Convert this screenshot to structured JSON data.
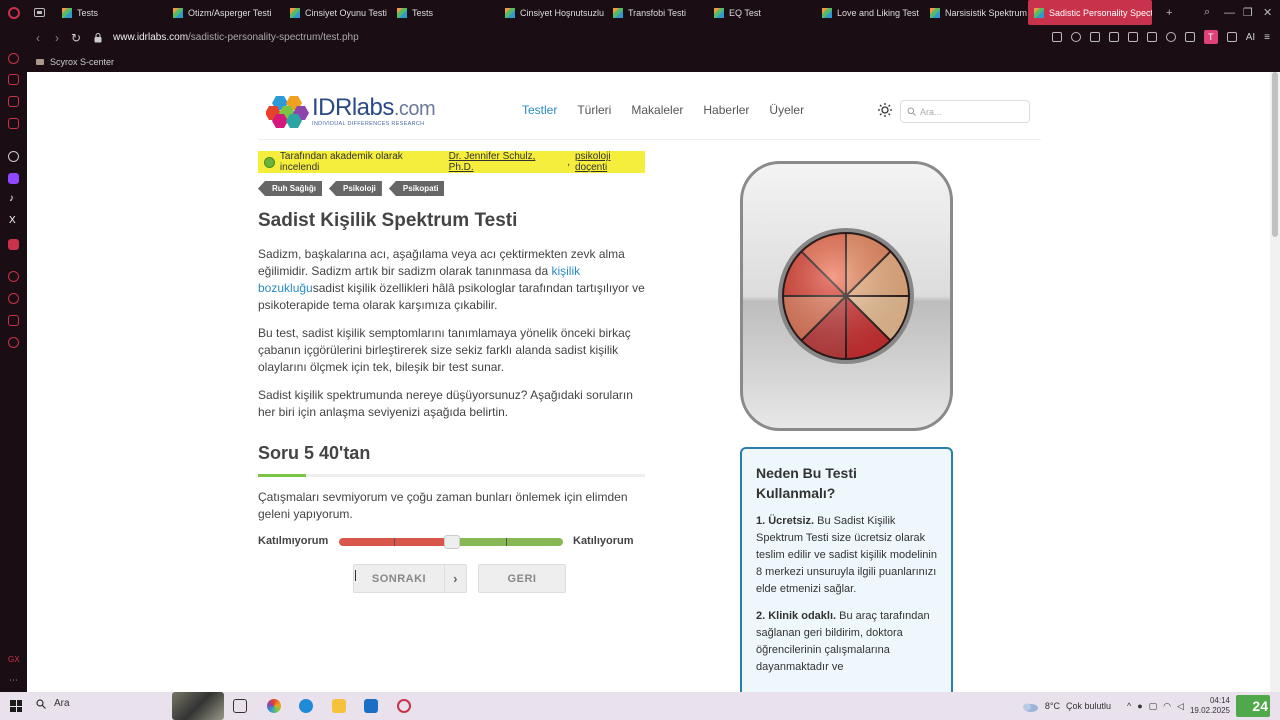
{
  "browser": {
    "tabs": [
      {
        "label": "Tests",
        "active": false
      },
      {
        "label": "Otizm/Asperger Testi",
        "active": false
      },
      {
        "label": "Cinsiyet Oyunu Testi",
        "active": false
      },
      {
        "label": "Tests",
        "active": false
      },
      {
        "label": "Cinsiyet Hoşnutsuzlu",
        "active": false
      },
      {
        "label": "Transfobi Testi",
        "active": false
      },
      {
        "label": "EQ Test",
        "active": false
      },
      {
        "label": "Love and Liking Test",
        "active": false
      },
      {
        "label": "Narsisistik Spektrum",
        "active": false
      },
      {
        "label": "Sadistic Personality Spect",
        "active": true
      }
    ],
    "new_tab": "+",
    "url_host": "www.idrlabs.com",
    "url_path": "/sadistic-personality-spectrum/test.php",
    "bookmark": "Scyrox S-center",
    "profile_initial": "T",
    "ai_label": "AI",
    "accent": "#c8324a"
  },
  "site": {
    "logo_main": "IDRlabs",
    "logo_dot": ".com",
    "logo_sub": "INDIVIDUAL DIFFERENCES RESEARCH",
    "nav": [
      "Testler",
      "Türleri",
      "Makaleler",
      "Haberler",
      "Üyeler"
    ],
    "active_nav": "Testler",
    "search_placeholder": "Ara...",
    "link_color": "#2a8bc4"
  },
  "banner": {
    "prefix": "Tarafından akademik olarak incelendi",
    "reviewer": "Dr. Jennifer Schulz, Ph.D.",
    "sep": ", ",
    "role": "psikoloji doçenti",
    "bg": "#f5ee3c"
  },
  "tags": [
    "Ruh Sağlığı",
    "Psikoloji",
    "Psikopati"
  ],
  "article": {
    "title": "Sadist Kişilik Spektrum Testi",
    "p1_a": "Sadizm, başkalarına acı, aşağılama veya acı çektirmekten zevk alma eğilimidir. Sadizm artık bir sadizm olarak tanınmasa da ",
    "p1_link": "kişilik bozukluğu",
    "p1_b": "sadist kişilik özellikleri hâlâ psikologlar tarafından tartışılıyor ve psikoterapide tema olarak karşımıza çıkabilir.",
    "p2": "Bu test, sadist kişilik semptomlarını tanımlamaya yönelik önceki birkaç çabanın içgörülerini birleştirerek size sekiz farklı alanda sadist kişilik olaylarını ölçmek için tek, bileşik bir test sunar.",
    "p3": "Sadist kişilik spektrumunda nereye düşüyorsunuz? Aşağıdaki soruların her biri için anlaşma seviyenizi aşağıda belirtin."
  },
  "question": {
    "title": "Soru 5 40'tan",
    "current": 5,
    "total": 40,
    "text": "Çatışmaları sevmiyorum ve çoğu zaman bunları önlemek için elimden geleni yapıyorum.",
    "label_left": "Katılmıyorum",
    "label_right": "Katılıyorum",
    "slider_value": 0.5,
    "next": "SONRAKI",
    "back": "GERI",
    "progress_color": "#7cc544"
  },
  "why": {
    "title": "Neden Bu Testi Kullanmalı?",
    "items": [
      {
        "head": "1. Ücretsiz.",
        "body": " Bu Sadist Kişilik Spektrum Testi size ücretsiz olarak teslim edilir ve sadist kişilik modelinin 8 merkezi unsuruyla ilgili puanlarınızı elde etmenizi sağlar."
      },
      {
        "head": "2. Klinik odaklı.",
        "body": " Bu araç tarafından sağlanan geri bildirim, doktora öğrencilerinin çalışmalarına dayanmaktadır ve"
      }
    ],
    "border": "#2a7fa8"
  },
  "taskbar": {
    "search": "Ara",
    "weather": "8°C",
    "weather_desc": "Çok bulutlu",
    "time": "04:14",
    "date": "19.02.2025",
    "badge": "24"
  }
}
